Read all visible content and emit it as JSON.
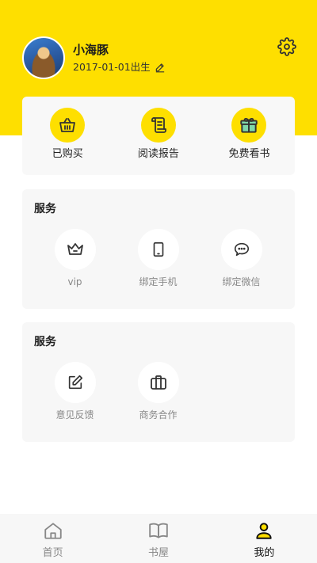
{
  "profile": {
    "username": "小海豚",
    "birth": "2017-01-01出生"
  },
  "quick_actions": [
    {
      "label": "已购买",
      "icon": "basket-icon"
    },
    {
      "label": "阅读报告",
      "icon": "scroll-icon"
    },
    {
      "label": "免费看书",
      "icon": "gift-icon"
    }
  ],
  "services_1": {
    "title": "服务",
    "items": [
      {
        "label": "vip",
        "icon": "crown-icon"
      },
      {
        "label": "绑定手机",
        "icon": "phone-icon"
      },
      {
        "label": "绑定微信",
        "icon": "chat-bubble-icon"
      }
    ]
  },
  "services_2": {
    "title": "服务",
    "items": [
      {
        "label": "意见反馈",
        "icon": "edit-note-icon"
      },
      {
        "label": "商务合作",
        "icon": "briefcase-icon"
      }
    ]
  },
  "tabs": [
    {
      "label": "首页",
      "icon": "home-icon",
      "active": false
    },
    {
      "label": "书屋",
      "icon": "book-icon",
      "active": false
    },
    {
      "label": "我的",
      "icon": "user-icon",
      "active": true
    }
  ],
  "colors": {
    "accent": "#fedf00",
    "icon_dark": "#333333",
    "muted_text": "#888888",
    "card_bg": "#f7f7f7"
  }
}
